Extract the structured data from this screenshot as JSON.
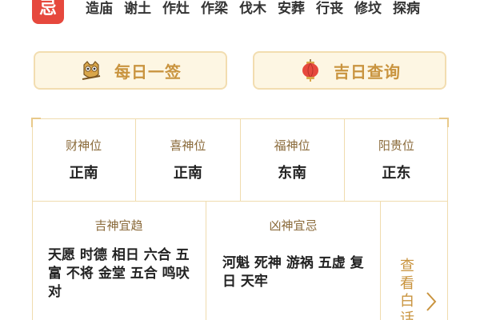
{
  "avoid": {
    "badge": "忌",
    "items": [
      "造庙",
      "谢土",
      "作灶",
      "作梁",
      "伐木",
      "安葬",
      "行丧",
      "修坟",
      "探病"
    ]
  },
  "buttons": {
    "daily_lot": "每日一签",
    "date_query": "吉日查询"
  },
  "directions": [
    {
      "label": "财神位",
      "value": "正南"
    },
    {
      "label": "喜神位",
      "value": "正南"
    },
    {
      "label": "福神位",
      "value": "东南"
    },
    {
      "label": "阳贵位",
      "value": "正东"
    }
  ],
  "gods_good": {
    "title": "吉神宜趋",
    "text": "天愿 时德 相日 六合 五富 不将 金堂 五合 鸣吠对"
  },
  "gods_bad": {
    "title": "凶神宜忌",
    "text": "河魁 死神 游祸 五虚 复日 天牢"
  },
  "more": {
    "label": "查看白话"
  },
  "colors": {
    "badge_red": "#e6483d",
    "gold_text": "#c9943f",
    "button_bg": "#fdf6e3",
    "border": "#f0dcae"
  }
}
